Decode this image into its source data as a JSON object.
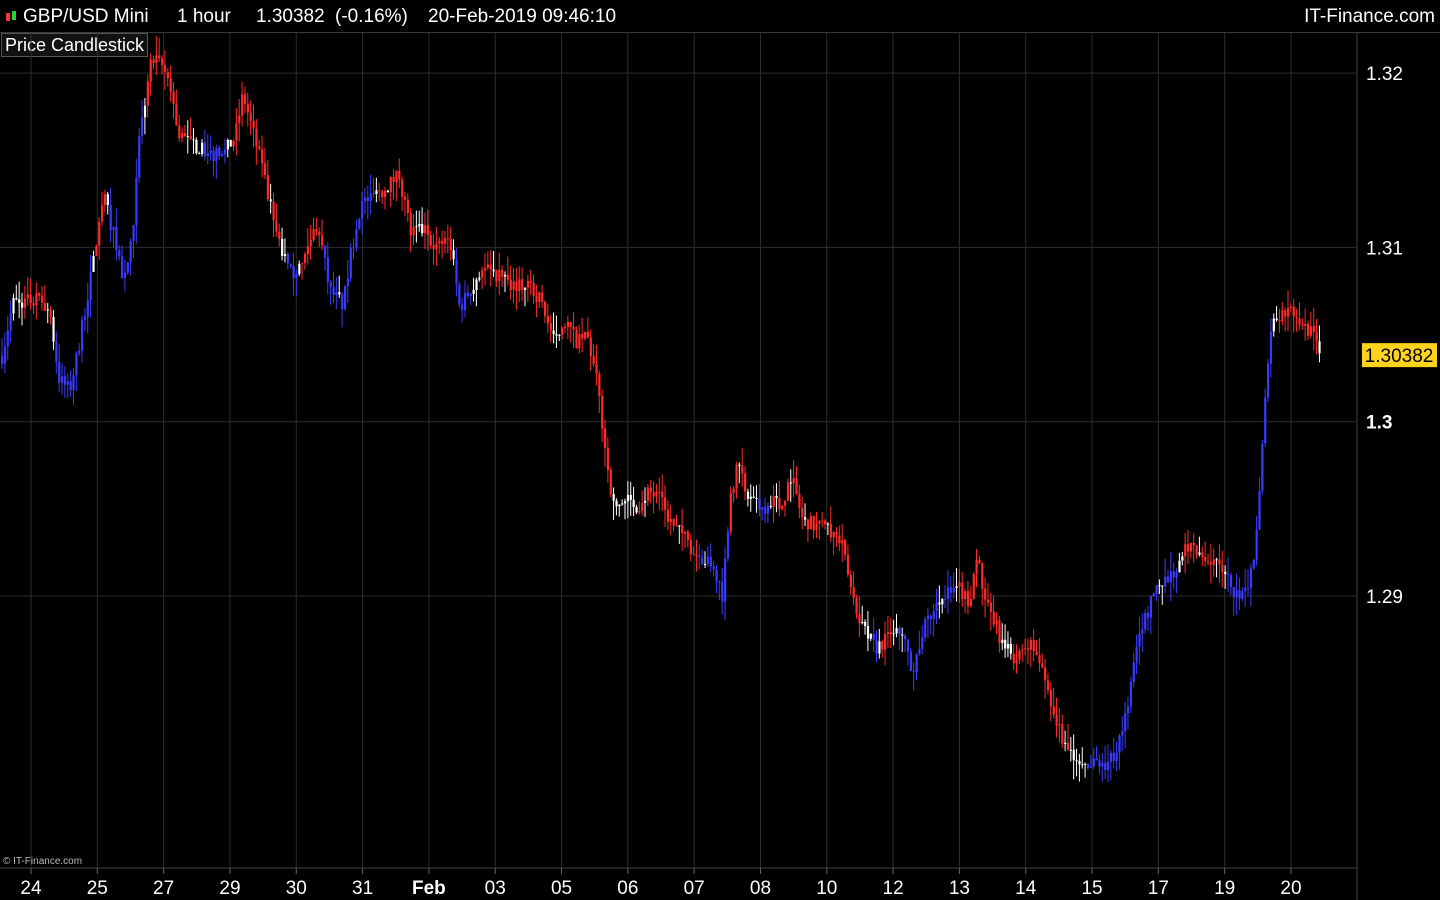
{
  "header": {
    "symbol": "GBP/USD Mini",
    "timeframe": "1 hour",
    "last_price": "1.30382",
    "change": "(-0.16%)",
    "datetime": "20-Feb-2019 09:46:10",
    "brand": "IT-Finance.com"
  },
  "indicator_tag": "Price Candlestick",
  "copyright": "© IT-Finance.com",
  "colors": {
    "up": "#3a3aff",
    "down": "#ff2a2a",
    "neutral": "#ffffff",
    "grid": "#2d2d2d",
    "price_badge": "#ffd21c"
  },
  "chart_data": {
    "type": "candlestick",
    "title": "GBP/USD Mini 1 hour",
    "ylim": [
      1.2744,
      1.3223
    ],
    "y_ticks": [
      {
        "value": 1.32,
        "label": "1.32"
      },
      {
        "value": 1.31,
        "label": "1.31"
      },
      {
        "value": 1.3,
        "label": "1.3"
      },
      {
        "value": 1.29,
        "label": "1.29"
      }
    ],
    "x_ticks": [
      "24",
      "25",
      "27",
      "29",
      "30",
      "31",
      "Feb",
      "03",
      "05",
      "06",
      "07",
      "08",
      "10",
      "12",
      "13",
      "14",
      "15",
      "17",
      "19",
      "20"
    ],
    "current_price_label": "1.30382",
    "current_price": 1.30382,
    "price_path": [
      [
        0.0,
        1.3038
      ],
      [
        0.008,
        1.3068
      ],
      [
        0.025,
        1.307
      ],
      [
        0.035,
        1.3065
      ],
      [
        0.042,
        1.3025
      ],
      [
        0.05,
        1.3018
      ],
      [
        0.056,
        1.304
      ],
      [
        0.066,
        1.3085
      ],
      [
        0.075,
        1.313
      ],
      [
        0.084,
        1.3103
      ],
      [
        0.09,
        1.308
      ],
      [
        0.097,
        1.3108
      ],
      [
        0.101,
        1.316
      ],
      [
        0.11,
        1.3207
      ],
      [
        0.117,
        1.3205
      ],
      [
        0.124,
        1.3195
      ],
      [
        0.13,
        1.3165
      ],
      [
        0.14,
        1.316
      ],
      [
        0.15,
        1.3155
      ],
      [
        0.162,
        1.3152
      ],
      [
        0.172,
        1.3163
      ],
      [
        0.178,
        1.3188
      ],
      [
        0.19,
        1.3152
      ],
      [
        0.202,
        1.311
      ],
      [
        0.212,
        1.3085
      ],
      [
        0.222,
        1.309
      ],
      [
        0.233,
        1.3115
      ],
      [
        0.242,
        1.3075
      ],
      [
        0.252,
        1.3067
      ],
      [
        0.258,
        1.3098
      ],
      [
        0.265,
        1.3125
      ],
      [
        0.275,
        1.313
      ],
      [
        0.285,
        1.3135
      ],
      [
        0.293,
        1.3143
      ],
      [
        0.302,
        1.3108
      ],
      [
        0.312,
        1.311
      ],
      [
        0.322,
        1.31
      ],
      [
        0.33,
        1.3108
      ],
      [
        0.338,
        1.3065
      ],
      [
        0.345,
        1.3075
      ],
      [
        0.355,
        1.3088
      ],
      [
        0.365,
        1.3085
      ],
      [
        0.375,
        1.308
      ],
      [
        0.385,
        1.3078
      ],
      [
        0.392,
        1.3075
      ],
      [
        0.398,
        1.307
      ],
      [
        0.408,
        1.3045
      ],
      [
        0.418,
        1.3055
      ],
      [
        0.425,
        1.3045
      ],
      [
        0.432,
        1.305
      ],
      [
        0.44,
        1.302
      ],
      [
        0.447,
        1.2975
      ],
      [
        0.452,
        1.295
      ],
      [
        0.46,
        1.2955
      ],
      [
        0.47,
        1.2952
      ],
      [
        0.478,
        1.296
      ],
      [
        0.486,
        1.2955
      ],
      [
        0.495,
        1.294
      ],
      [
        0.503,
        1.2935
      ],
      [
        0.511,
        1.2925
      ],
      [
        0.52,
        1.292
      ],
      [
        0.527,
        1.2915
      ],
      [
        0.532,
        1.29
      ],
      [
        0.538,
        1.296
      ],
      [
        0.544,
        1.2975
      ],
      [
        0.552,
        1.2955
      ],
      [
        0.56,
        1.295
      ],
      [
        0.57,
        1.2955
      ],
      [
        0.575,
        1.295
      ],
      [
        0.583,
        1.297
      ],
      [
        0.591,
        1.2945
      ],
      [
        0.6,
        1.294
      ],
      [
        0.61,
        1.294
      ],
      [
        0.62,
        1.293
      ],
      [
        0.628,
        1.29
      ],
      [
        0.637,
        1.288
      ],
      [
        0.645,
        1.287
      ],
      [
        0.655,
        1.2876
      ],
      [
        0.665,
        1.288
      ],
      [
        0.672,
        1.2855
      ],
      [
        0.68,
        1.288
      ],
      [
        0.69,
        1.2895
      ],
      [
        0.697,
        1.29
      ],
      [
        0.707,
        1.2905
      ],
      [
        0.714,
        1.2895
      ],
      [
        0.72,
        1.2925
      ],
      [
        0.726,
        1.2895
      ],
      [
        0.733,
        1.2885
      ],
      [
        0.74,
        1.287
      ],
      [
        0.75,
        1.2864
      ],
      [
        0.76,
        1.2872
      ],
      [
        0.765,
        1.2865
      ],
      [
        0.772,
        1.2848
      ],
      [
        0.778,
        1.283
      ],
      [
        0.784,
        1.2815
      ],
      [
        0.79,
        1.2808
      ],
      [
        0.795,
        1.2803
      ],
      [
        0.802,
        1.28
      ],
      [
        0.808,
        1.2805
      ],
      [
        0.815,
        1.2803
      ],
      [
        0.822,
        1.281
      ],
      [
        0.828,
        1.2825
      ],
      [
        0.834,
        1.285
      ],
      [
        0.84,
        1.288
      ],
      [
        0.846,
        1.289
      ],
      [
        0.852,
        1.2905
      ],
      [
        0.86,
        1.291
      ],
      [
        0.868,
        1.2915
      ],
      [
        0.876,
        1.293
      ],
      [
        0.884,
        1.2924
      ],
      [
        0.892,
        1.292
      ],
      [
        0.9,
        1.292
      ],
      [
        0.906,
        1.2908
      ],
      [
        0.912,
        1.29
      ],
      [
        0.918,
        1.29
      ],
      [
        0.924,
        1.292
      ],
      [
        0.928,
        1.295
      ],
      [
        0.932,
        1.3
      ],
      [
        0.936,
        1.305
      ],
      [
        0.94,
        1.306
      ],
      [
        0.944,
        1.3062
      ],
      [
        0.95,
        1.3065
      ],
      [
        0.956,
        1.3062
      ],
      [
        0.962,
        1.3055
      ],
      [
        0.968,
        1.305
      ],
      [
        0.973,
        1.3038
      ]
    ]
  }
}
